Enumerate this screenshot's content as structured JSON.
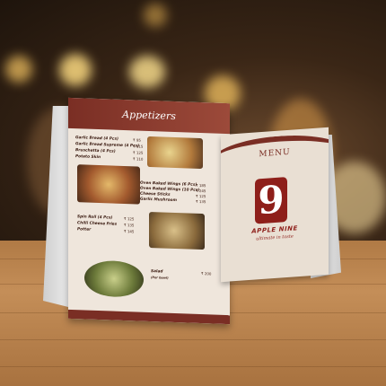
{
  "menu_card": {
    "title": "Appetizers",
    "items": [
      {
        "name": "Garlic Bread (4 Pcs)",
        "price": "₹ 95"
      },
      {
        "name": "Garlic Bread Supreme (4 Pcs)",
        "price": "₹ 115"
      },
      {
        "name": "Bruschetta (4 Pcs)",
        "price": "₹ 125"
      },
      {
        "name": "Potato Skin",
        "price": "₹ 110"
      },
      {
        "name": "Oven Baked Wings (6 Pcs)",
        "price": "₹ 185"
      },
      {
        "name": "Oven Baked Wings (10 Pcs)",
        "price": "₹ 245"
      },
      {
        "name": "Cheese Sticks",
        "price": "₹ 125"
      },
      {
        "name": "Garlic Mushroom",
        "price": "₹ 135"
      },
      {
        "name": "Spin Roll (4 Pcs)",
        "price": "₹ 125"
      },
      {
        "name": "Chilli Cheese Fries",
        "price": "₹ 135"
      },
      {
        "name": "Potter",
        "price": "₹ 145"
      },
      {
        "name": "Salad",
        "price": "₹ 200"
      }
    ],
    "salad_note": "(Per bowl)"
  },
  "tent_card": {
    "label": "MENU",
    "logo_numeral": "9",
    "brand": "APPLE NINE",
    "tagline": "ultimate in taste"
  }
}
